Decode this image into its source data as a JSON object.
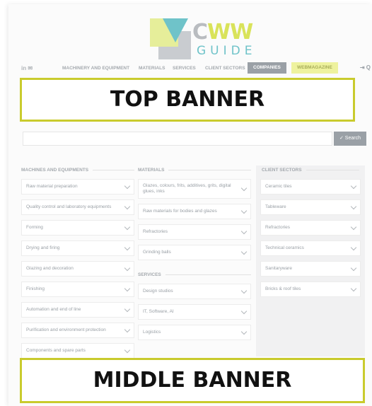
{
  "logo": {
    "word_c": "C",
    "word_ww": "WW",
    "sub": "GUIDE"
  },
  "nav": {
    "social": "in ✉",
    "items": [
      "MACHINERY AND EQUIPMENT",
      "MATERIALS",
      "SERVICES",
      "CLIENT SECTORS"
    ],
    "companies": "COMPANIES",
    "magazine": "WEBMAGAZINE",
    "right": "⇥ Q"
  },
  "banners": {
    "top": "TOP BANNER",
    "middle": "MIDDLE BANNER"
  },
  "search": {
    "placeholder": "",
    "button": "✓ Search"
  },
  "machines": {
    "title": "MACHINES AND EQUIPMENTS",
    "items": [
      "Raw material preparation",
      "Quality control and laboratory equipments",
      "Forming",
      "Drying and firing",
      "Glazing and decoration",
      "Finishing",
      "Automation and end of line",
      "Purification and environment protection",
      "Components and spare parts"
    ]
  },
  "materials": {
    "title": "MATERIALS",
    "items": [
      "Glazes, colours, frits, additives, grits, digital glues, inks",
      "Raw materials for bodies and glazes",
      "Refractories",
      "Grinding balls"
    ]
  },
  "services": {
    "title": "SERVICES",
    "items": [
      "Design studios",
      "IT, Software, AI",
      "Logistics"
    ]
  },
  "client_sectors": {
    "title": "CLIENT SECTORS",
    "items": [
      "Ceramic tiles",
      "Tableware",
      "Refractories",
      "Technical ceramics",
      "Sanitaryware",
      "Bricks & roof tiles"
    ]
  }
}
